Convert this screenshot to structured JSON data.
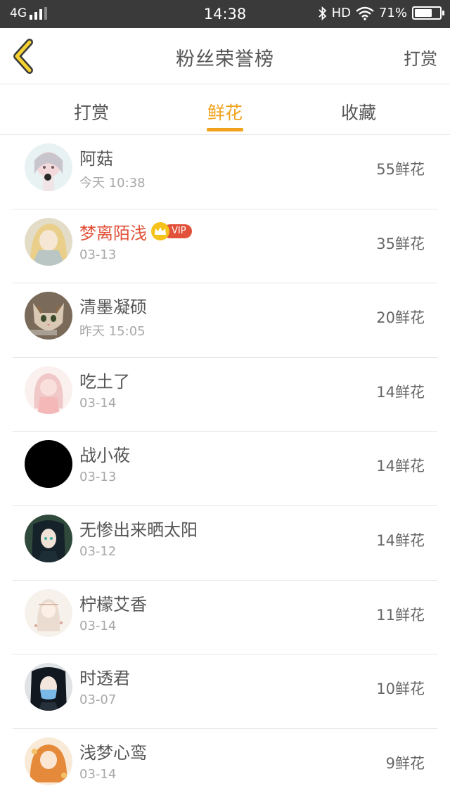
{
  "status_bar": {
    "network": "4G",
    "time": "14:38",
    "hd": "HD",
    "battery": "71%",
    "battery_level": 0.71
  },
  "header": {
    "back_icon": "chevron-left-icon",
    "title": "粉丝荣誉榜",
    "action": "打赏"
  },
  "tabs": [
    {
      "label": "打赏",
      "active": false
    },
    {
      "label": "鲜花",
      "active": true
    },
    {
      "label": "收藏",
      "active": false
    }
  ],
  "accent_color": "#f0a21c",
  "vip_color": "#e2523a",
  "fans": [
    {
      "name": "阿菇",
      "time": "今天 10:38",
      "score": "55鲜花",
      "vip": false
    },
    {
      "name": "梦离陌浅",
      "time": "03-13",
      "score": "35鲜花",
      "vip": true,
      "vip_label": "VIP"
    },
    {
      "name": "清墨凝硕",
      "time": "昨天 15:05",
      "score": "20鲜花",
      "vip": false
    },
    {
      "name": "吃土了",
      "time": "03-14",
      "score": "14鲜花",
      "vip": false
    },
    {
      "name": "战小莜",
      "time": "03-13",
      "score": "14鲜花",
      "vip": false
    },
    {
      "name": "无惨出来晒太阳",
      "time": "03-12",
      "score": "14鲜花",
      "vip": false
    },
    {
      "name": "柠檬艾香",
      "time": "03-14",
      "score": "11鲜花",
      "vip": false
    },
    {
      "name": "时透君",
      "time": "03-07",
      "score": "10鲜花",
      "vip": false
    },
    {
      "name": "浅梦心鸾",
      "time": "03-14",
      "score": "9鲜花",
      "vip": false
    }
  ]
}
